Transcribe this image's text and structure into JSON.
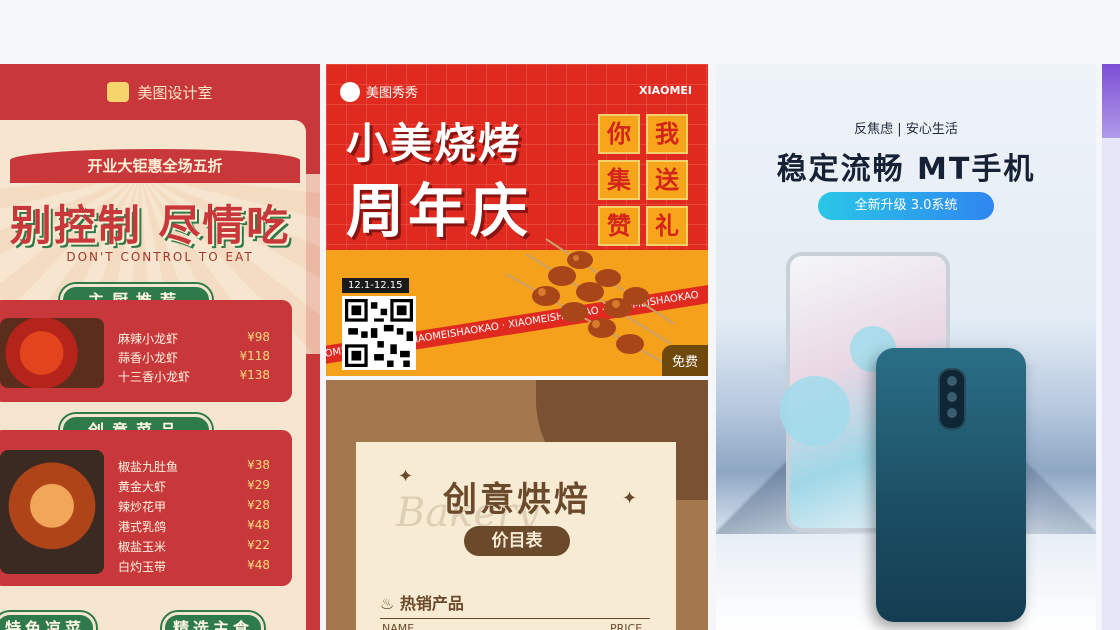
{
  "card1": {
    "brand": "美图设计室",
    "ribbon": "开业大钜惠全场五折",
    "headline": "别控制 尽情吃",
    "subtitle": "DON'T CONTROL TO EAT",
    "section1": "主厨推荐",
    "section1_items": [
      {
        "name": "麻辣小龙虾",
        "price": "¥98"
      },
      {
        "name": "蒜香小龙虾",
        "price": "¥118"
      },
      {
        "name": "十三香小龙虾",
        "price": "¥138"
      }
    ],
    "section2": "创意菜品",
    "section2_items": [
      {
        "name": "椒盐九肚鱼",
        "price": "¥38"
      },
      {
        "name": "黄金大虾",
        "price": "¥29"
      },
      {
        "name": "辣炒花甲",
        "price": "¥28"
      },
      {
        "name": "港式乳鸽",
        "price": "¥48"
      },
      {
        "name": "椒盐玉米",
        "price": "¥22"
      },
      {
        "name": "白灼玉带",
        "price": "¥48"
      }
    ],
    "bottom_left": "特色凉菜",
    "bottom_right": "精选主食"
  },
  "card2": {
    "brand": "美图秀秀",
    "brand_right": "XIAOMEI",
    "title_line1": "小美烧烤",
    "title_line2": "周年庆",
    "tiles": [
      "你",
      "我",
      "集",
      "送",
      "赞",
      "礼"
    ],
    "dates": "12.1-12.15",
    "band_text": "XIAOMEISHAOKAO · XIAOMEISHAOKAO · XIAOMEISHAOKAO · XIAOMEISHAOKAO",
    "free_badge": "免费"
  },
  "card3": {
    "title": "创意烘焙",
    "script_word": "Bakery",
    "pill": "价目表",
    "section": "热销产品",
    "col_name": "NAME",
    "col_price": "PRICE"
  },
  "card4": {
    "tagline": "反焦虑 | 安心生活",
    "headline": "稳定流畅 MT手机",
    "button": "全新升级 3.0系统"
  }
}
